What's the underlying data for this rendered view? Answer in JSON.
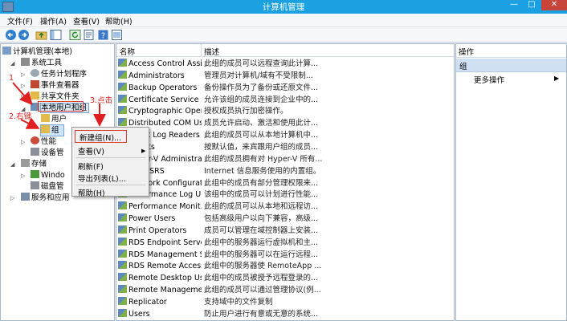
{
  "window": {
    "title": "计算机管理",
    "min_glyph": "—",
    "max_glyph": "□",
    "close_glyph": "✕"
  },
  "menu": [
    "文件(F)",
    "操作(A)",
    "查看(V)",
    "帮助(H)"
  ],
  "tree": {
    "root": "计算机管理(本地)",
    "system_tools": "系统工具",
    "task_scheduler": "任务计划程序",
    "event_viewer": "事件查看器",
    "shared_folders": "共享文件夹",
    "local_users_groups": "本地用户和组",
    "users": "用户",
    "groups": "组",
    "performance": "性能",
    "device_manager": "设备管",
    "storage": "存储",
    "windows_backup": "Windo",
    "disk_mgmt": "磁盘管",
    "services_apps": "服务和应用"
  },
  "list": {
    "col_name": "名称",
    "col_desc": "描述",
    "rows": [
      {
        "name": "Access Control Assi...",
        "desc": "此组的成员可以远程查询此计算..."
      },
      {
        "name": "Administrators",
        "desc": "管理员对计算机/域有不受限制..."
      },
      {
        "name": "Backup Operators",
        "desc": "备份操作员为了备份或还原文件..."
      },
      {
        "name": "Certificate Service D...",
        "desc": "允许该组的成员连接到企业中的..."
      },
      {
        "name": "Cryptographic Oper...",
        "desc": "授权成员执行加密操作。"
      },
      {
        "name": "Distributed COM Us...",
        "desc": "成员允许启动、激活和使用此计..."
      },
      {
        "name": "Event Log Readers",
        "desc": "此组的成员可以从本地计算机中..."
      },
      {
        "name": "Guests",
        "desc": "按默认值，来宾跟用户组的成员..."
      },
      {
        "name": "Hyper-V Administra...",
        "desc": "此组的成员拥有对 Hyper-V 所有..."
      },
      {
        "name": "IIS_IUSRS",
        "desc": "Internet 信息服务使用的内置组。"
      },
      {
        "name": "Network Configurat...",
        "desc": "此组中的成员有部分管理权限来..."
      },
      {
        "name": "Performance Log U...",
        "desc": "该组中的成员可以计划进行性能..."
      },
      {
        "name": "Performance Monit...",
        "desc": "此组的成员可以从本地和远程访..."
      },
      {
        "name": "Power Users",
        "desc": "包括高级用户以向下兼容，高级..."
      },
      {
        "name": "Print Operators",
        "desc": "成员可以管理在域控制器上安装..."
      },
      {
        "name": "RDS Endpoint Serve...",
        "desc": "此组中的服务器运行虚拟机和主..."
      },
      {
        "name": "RDS Management S...",
        "desc": "此组中的服务器可以在运行远程..."
      },
      {
        "name": "RDS Remote Access...",
        "desc": "此组中的服务器使 RemoteApp ..."
      },
      {
        "name": "Remote Desktop Us...",
        "desc": "此组中的成员被授予远程登录的..."
      },
      {
        "name": "Remote Manageme...",
        "desc": "此组的成员可以通过管理协议(例..."
      },
      {
        "name": "Replicator",
        "desc": "支持域中的文件复制"
      },
      {
        "name": "Users",
        "desc": "防止用户进行有意或无意的系统..."
      }
    ]
  },
  "actions": {
    "header": "操作",
    "group": "组",
    "more": "更多操作"
  },
  "context_menu": {
    "new_group": "新建组(N)...",
    "view": "查看(V)",
    "refresh": "刷新(F)",
    "export": "导出列表(L)...",
    "help": "帮助(H)"
  },
  "annotations": {
    "step1": "1",
    "step2": "2.右键",
    "step3": "3.点击"
  },
  "colors": {
    "titlebar": "#1ba1e2",
    "annotation": "#e02020",
    "action_group_bg": "#cfe0f3"
  }
}
